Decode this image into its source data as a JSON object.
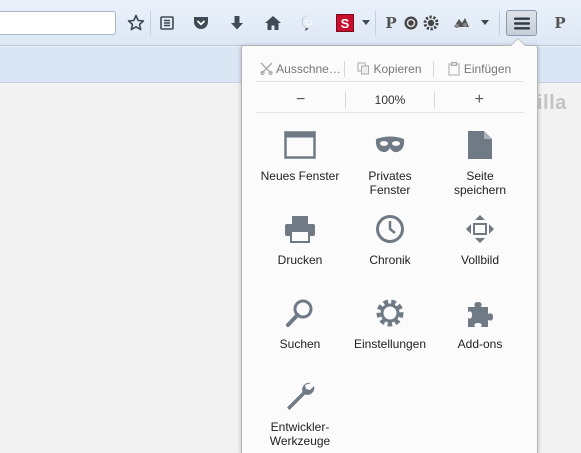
{
  "colors": {
    "icon": "#6f7a84",
    "text": "#222222",
    "toolbar_bg": "#dde7f4",
    "panel_bg": "#fbfbfb",
    "addon_red": "#c8102e"
  },
  "toolbar": {
    "url_value": "",
    "icons": [
      "star-icon",
      "reading-list-icon",
      "pocket-icon",
      "download-icon",
      "home-icon",
      "smiley-icon",
      "s-addon-icon",
      "dropdown-icon",
      "p-addon-icon",
      "refresh-addon-icon",
      "gear-addon-icon",
      "bug-addon-icon",
      "dropdown-icon",
      "hamburger-menu-icon",
      "p-addon-icon"
    ],
    "s_badge": "S",
    "p_badge": "P"
  },
  "background_text": "illa",
  "menu": {
    "edit": {
      "cut": "Ausschne…",
      "copy": "Kopieren",
      "paste": "Einfügen"
    },
    "zoom": {
      "minus": "−",
      "value": "100%",
      "plus": "+"
    },
    "items": [
      {
        "label": "Neues Fenster",
        "icon": "window-icon"
      },
      {
        "label": "Privates\nFenster",
        "icon": "mask-icon"
      },
      {
        "label": "Seite\nspeichern",
        "icon": "page-icon"
      },
      {
        "label": "Drucken",
        "icon": "printer-icon"
      },
      {
        "label": "Chronik",
        "icon": "clock-icon"
      },
      {
        "label": "Vollbild",
        "icon": "fullscreen-icon"
      },
      {
        "label": "Suchen",
        "icon": "magnifier-icon"
      },
      {
        "label": "Einstellungen",
        "icon": "gear-icon"
      },
      {
        "label": "Add-ons",
        "icon": "puzzle-icon"
      },
      {
        "label": "Entwickler-\nWerkzeuge",
        "icon": "wrench-icon"
      }
    ]
  }
}
